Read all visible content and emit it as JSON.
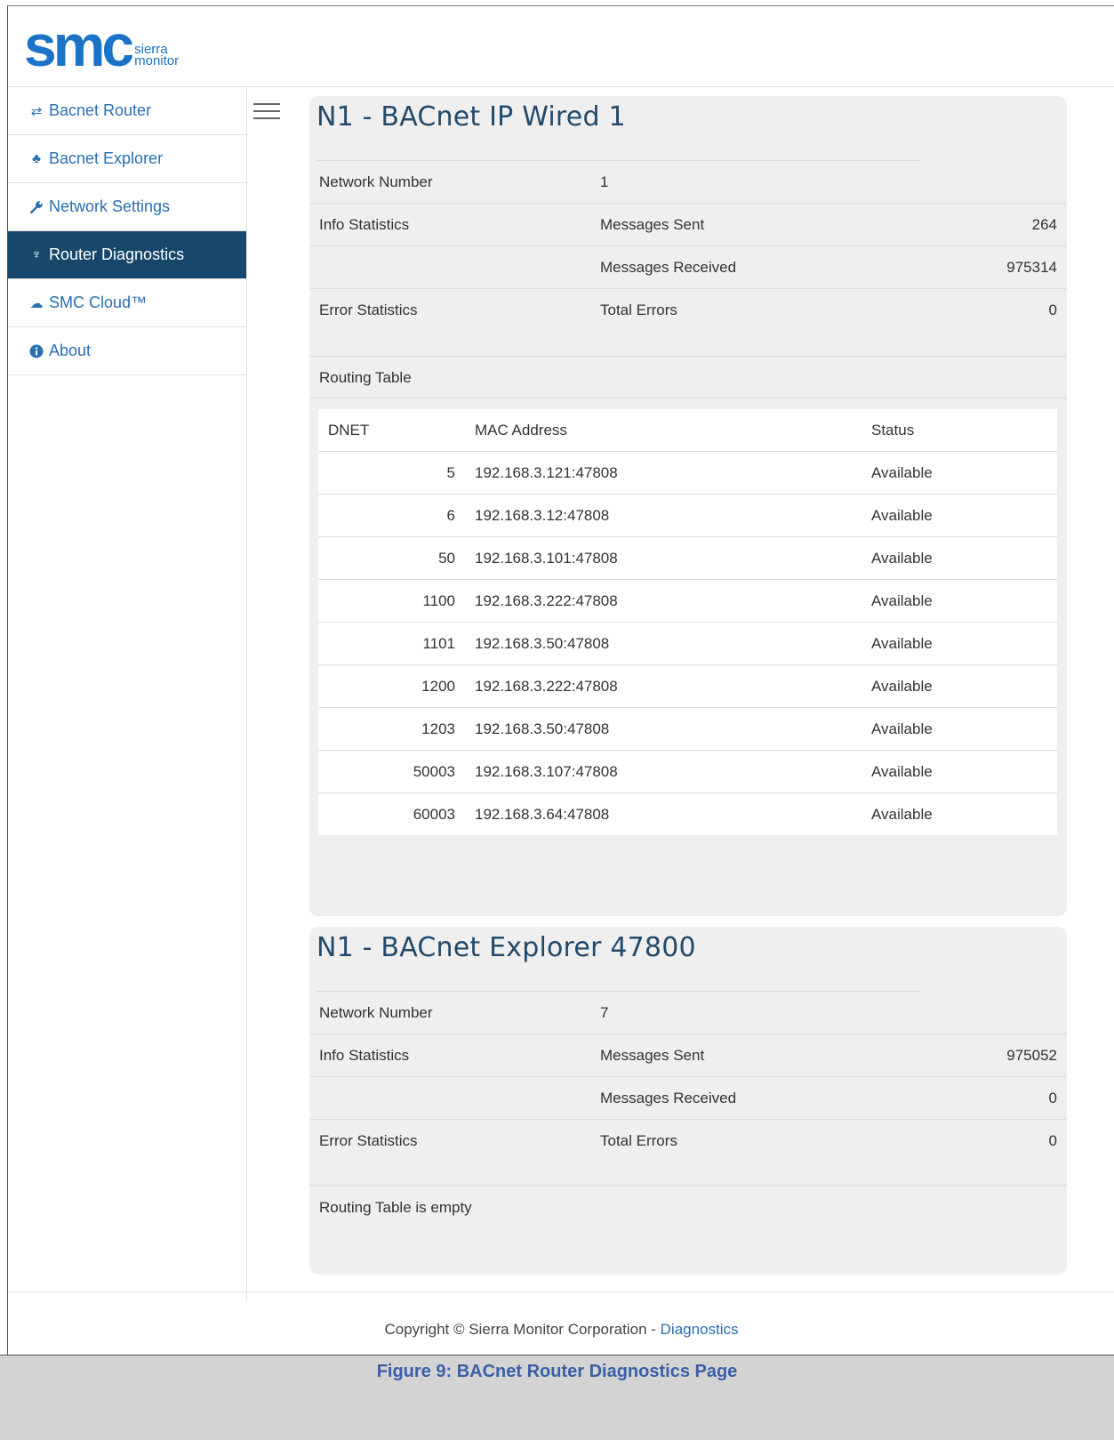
{
  "logo": {
    "letters": "smc",
    "sub_line1": "sierra",
    "sub_line2": "monitor"
  },
  "sidebar": {
    "items": [
      {
        "label": "Bacnet Router",
        "icon": "exchange-icon",
        "glyph": "⇄",
        "active": false
      },
      {
        "label": "Bacnet Explorer",
        "icon": "sitemap-icon",
        "glyph": "♣",
        "active": false
      },
      {
        "label": "Network Settings",
        "icon": "wrench-icon",
        "glyph": "🔧",
        "active": false
      },
      {
        "label": "Router Diagnostics",
        "icon": "stethoscope-icon",
        "glyph": "♆",
        "active": true
      },
      {
        "label": "SMC Cloud™",
        "icon": "cloud-icon",
        "glyph": "☁",
        "active": false
      },
      {
        "label": "About",
        "icon": "info-icon",
        "glyph": "ℹ",
        "active": false
      }
    ]
  },
  "panels": [
    {
      "title": "N1 - BACnet IP Wired 1",
      "network_number_label": "Network Number",
      "network_number": "1",
      "info_label": "Info Statistics",
      "sent_label": "Messages Sent",
      "sent_value": "264",
      "received_label": "Messages Received",
      "received_value": "975314",
      "error_label": "Error Statistics",
      "errors_label": "Total Errors",
      "errors_value": "0",
      "routing_label": "Routing Table",
      "routing_table": {
        "headers": [
          "DNET",
          "MAC Address",
          "Status"
        ],
        "rows": [
          [
            "5",
            "192.168.3.121:47808",
            "Available"
          ],
          [
            "6",
            "192.168.3.12:47808",
            "Available"
          ],
          [
            "50",
            "192.168.3.101:47808",
            "Available"
          ],
          [
            "1100",
            "192.168.3.222:47808",
            "Available"
          ],
          [
            "1101",
            "192.168.3.50:47808",
            "Available"
          ],
          [
            "1200",
            "192.168.3.222:47808",
            "Available"
          ],
          [
            "1203",
            "192.168.3.50:47808",
            "Available"
          ],
          [
            "50003",
            "192.168.3.107:47808",
            "Available"
          ],
          [
            "60003",
            "192.168.3.64:47808",
            "Available"
          ]
        ]
      }
    },
    {
      "title": "N1 - BACnet Explorer 47800",
      "network_number_label": "Network Number",
      "network_number": "7",
      "info_label": "Info Statistics",
      "sent_label": "Messages Sent",
      "sent_value": "975052",
      "received_label": "Messages Received",
      "received_value": "0",
      "error_label": "Error Statistics",
      "errors_label": "Total Errors",
      "errors_value": "0",
      "routing_label": "Routing Table is empty"
    }
  ],
  "footer": {
    "copyright": "Copyright © Sierra Monitor Corporation - ",
    "link": "Diagnostics"
  },
  "caption": "Figure 9: BACnet Router Diagnostics Page"
}
